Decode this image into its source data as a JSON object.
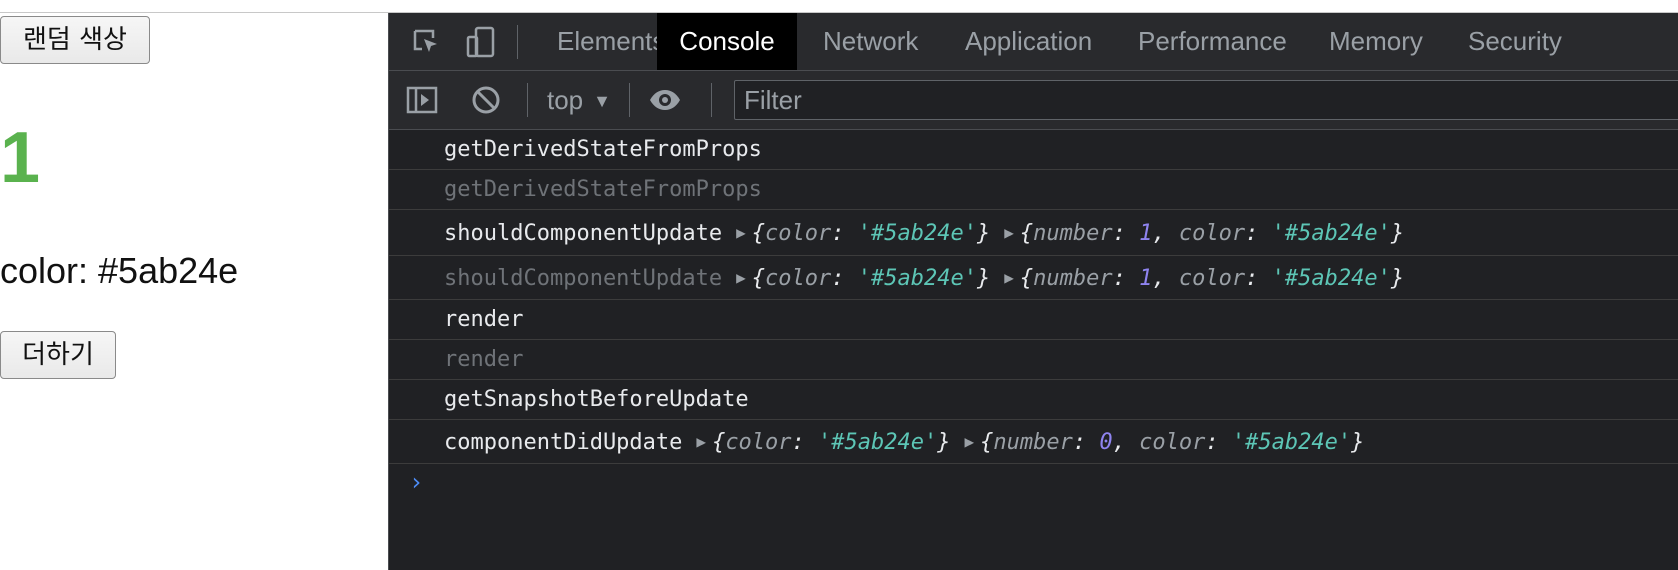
{
  "page": {
    "random_button": "랜덤 색상",
    "number": "1",
    "number_color": "#5ab24e",
    "color_text": "color: #5ab24e",
    "add_button": "더하기"
  },
  "devtools": {
    "tabs": [
      "Elements",
      "Console",
      "Network",
      "Application",
      "Performance",
      "Memory",
      "Security"
    ],
    "active_tab": "Console",
    "context": "top",
    "filter_placeholder": "Filter",
    "icons": [
      "inspect-element-icon",
      "device-toolbar-icon",
      "sidebar-toggle-icon",
      "clear-console-icon",
      "eye-icon"
    ]
  },
  "console": {
    "rows": [
      {
        "text": "getDerivedStateFromProps",
        "dim": false
      },
      {
        "text": "getDerivedStateFromProps",
        "dim": true
      },
      {
        "text": "shouldComponentUpdate",
        "dim": false,
        "obj1": {
          "color": "'#5ab24e'"
        },
        "obj2": {
          "number": "1",
          "color": "'#5ab24e'"
        }
      },
      {
        "text": "shouldComponentUpdate",
        "dim": true,
        "obj1": {
          "color": "'#5ab24e'"
        },
        "obj2": {
          "number": "1",
          "color": "'#5ab24e'"
        }
      },
      {
        "text": "render",
        "dim": false
      },
      {
        "text": "render",
        "dim": true
      },
      {
        "text": "getSnapshotBeforeUpdate",
        "dim": false
      },
      {
        "text": "componentDidUpdate",
        "dim": false,
        "obj1": {
          "color": "'#5ab24e'"
        },
        "obj2": {
          "number": "0",
          "color": "'#5ab24e'"
        }
      }
    ],
    "prompt": "›"
  }
}
